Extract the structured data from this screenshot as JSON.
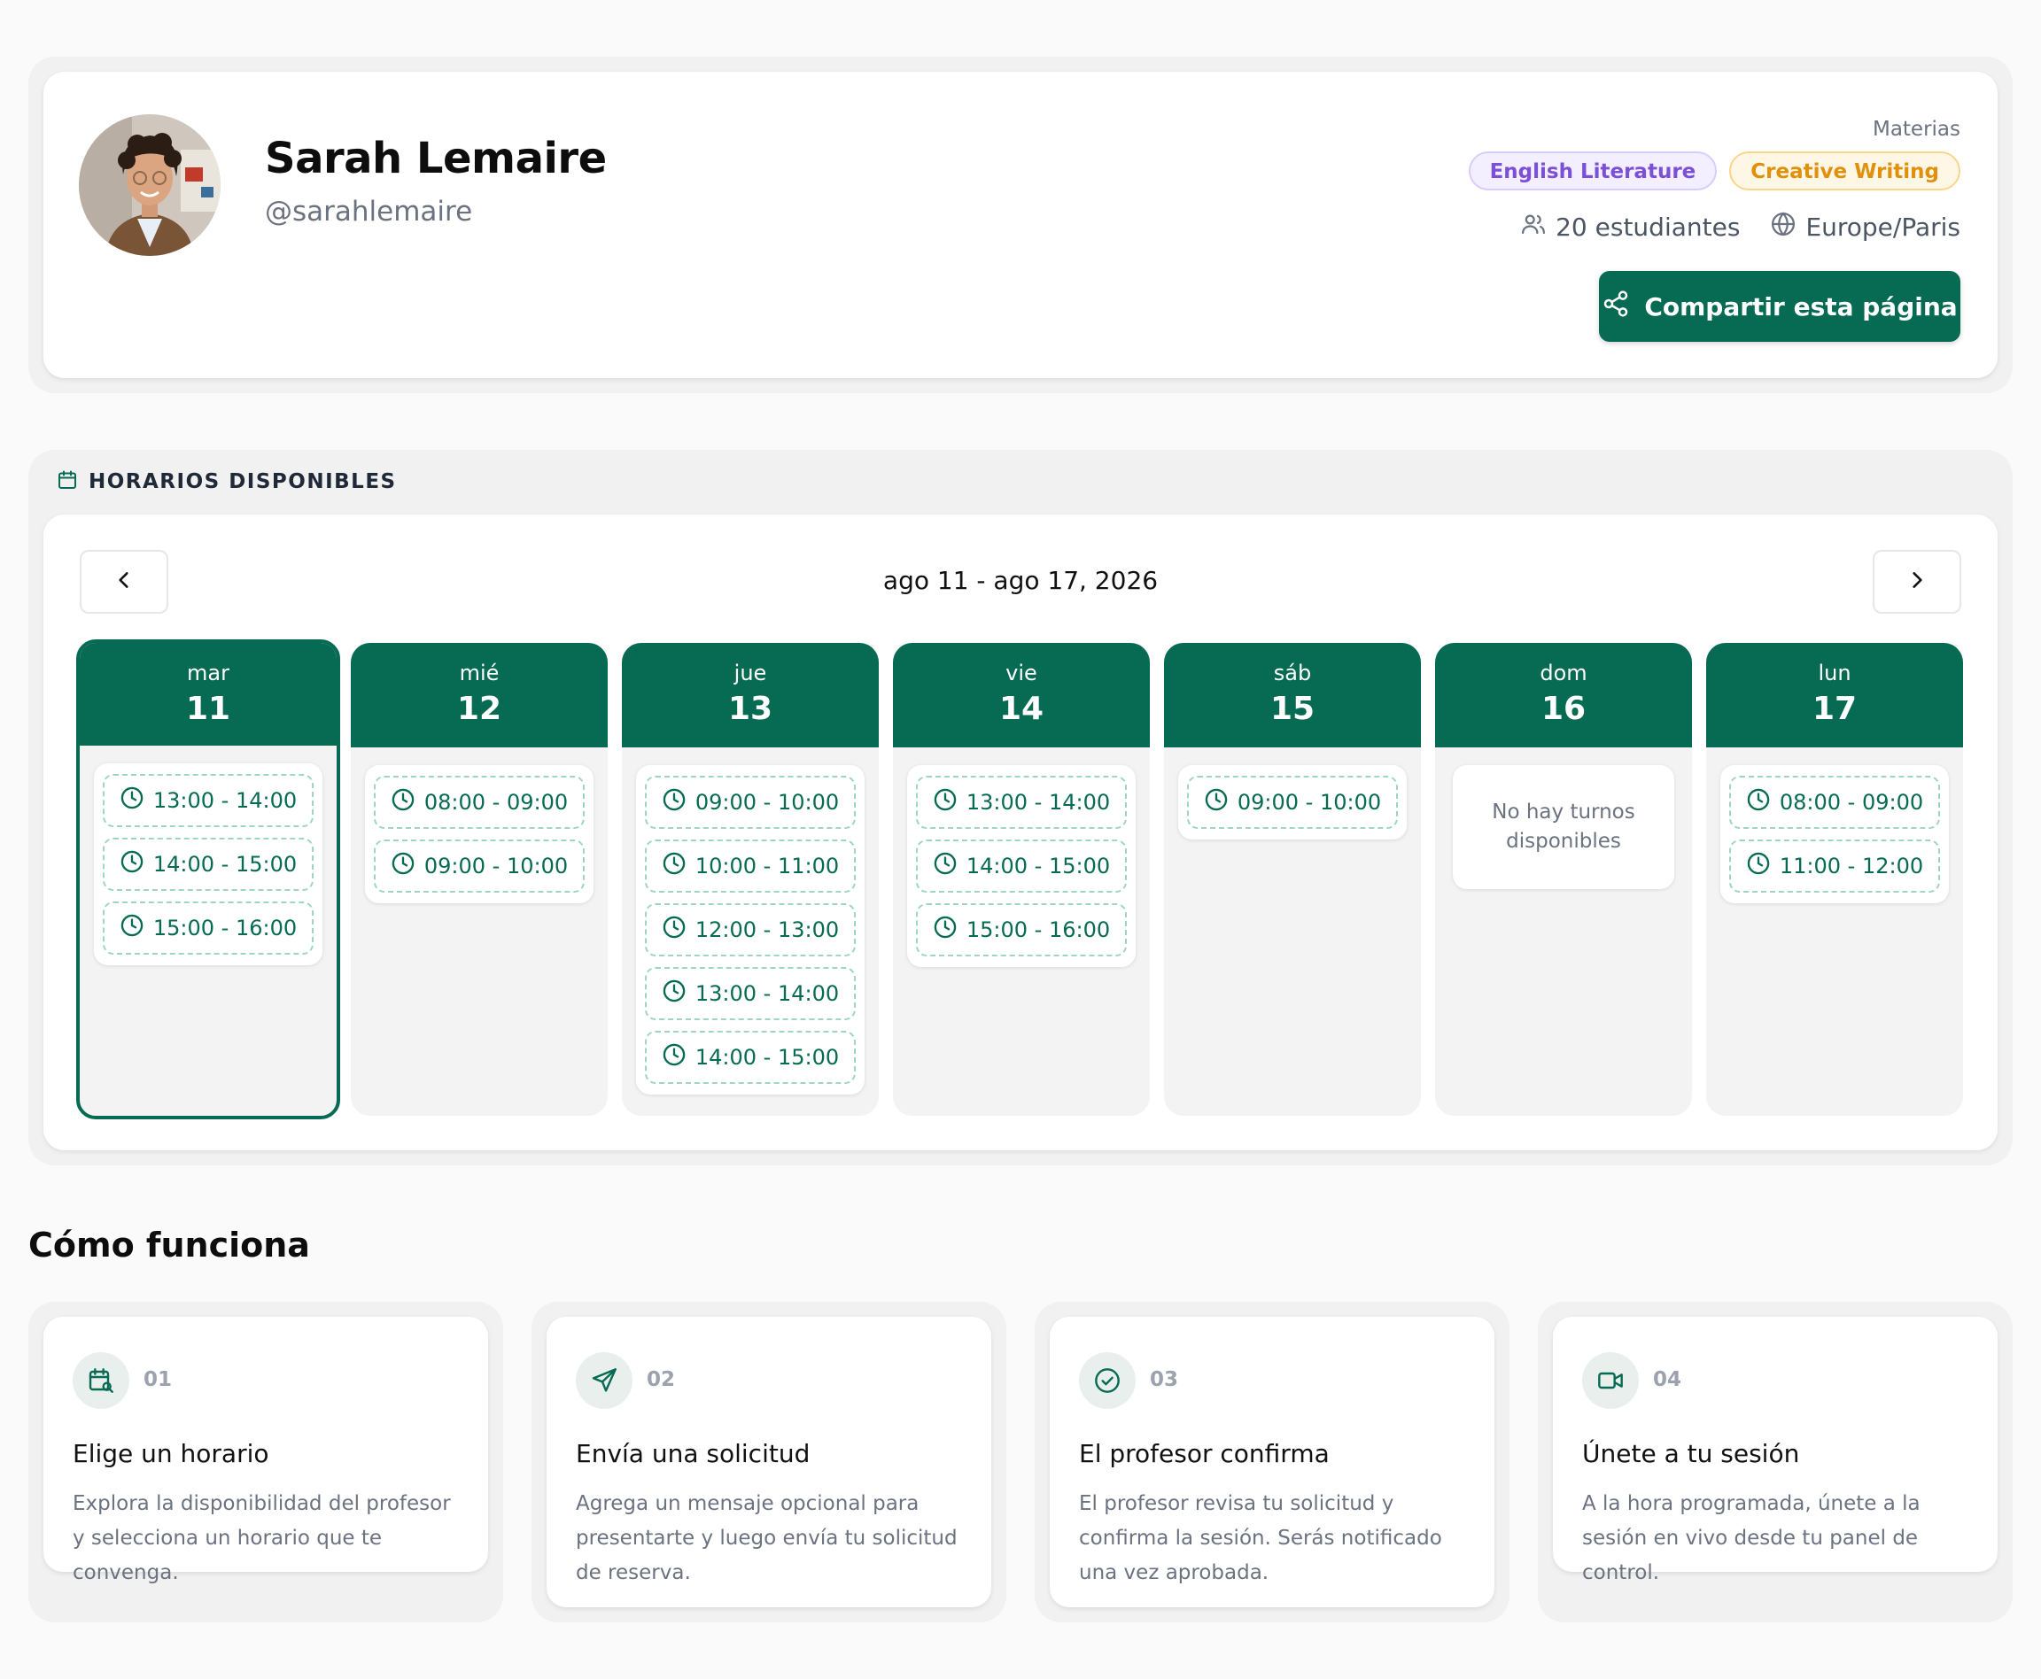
{
  "profile": {
    "name": "Sarah Lemaire",
    "handle": "@sarahlemaire",
    "subjects_label": "Materias",
    "subjects": [
      "English Literature",
      "Creative Writing"
    ],
    "students": "20 estudiantes",
    "timezone": "Europe/Paris",
    "share_label": "Compartir esta página"
  },
  "availability": {
    "title": "HORARIOS DISPONIBLES",
    "week_range": "ago 11 - ago 17, 2026",
    "empty_text": "No hay turnos disponibles",
    "days": [
      {
        "name": "mar",
        "num": "11",
        "slots": [
          "13:00 - 14:00",
          "14:00 - 15:00",
          "15:00 - 16:00"
        ]
      },
      {
        "name": "mié",
        "num": "12",
        "slots": [
          "08:00 - 09:00",
          "09:00 - 10:00"
        ]
      },
      {
        "name": "jue",
        "num": "13",
        "slots": [
          "09:00 - 10:00",
          "10:00 - 11:00",
          "12:00 - 13:00",
          "13:00 - 14:00",
          "14:00 - 15:00"
        ]
      },
      {
        "name": "vie",
        "num": "14",
        "slots": [
          "13:00 - 14:00",
          "14:00 - 15:00",
          "15:00 - 16:00"
        ]
      },
      {
        "name": "sáb",
        "num": "15",
        "slots": [
          "09:00 - 10:00"
        ]
      },
      {
        "name": "dom",
        "num": "16",
        "slots": []
      },
      {
        "name": "lun",
        "num": "17",
        "slots": [
          "08:00 - 09:00",
          "11:00 - 12:00"
        ]
      }
    ]
  },
  "how": {
    "title": "Cómo funciona",
    "steps": [
      {
        "num": "01",
        "icon": "calendar-search-icon",
        "title": "Elige un horario",
        "desc": "Explora la disponibilidad del profesor y selecciona un horario que te convenga."
      },
      {
        "num": "02",
        "icon": "send-icon",
        "title": "Envía una solicitud",
        "desc": "Agrega un mensaje opcional para presentarte y luego envía tu solicitud de reserva."
      },
      {
        "num": "03",
        "icon": "check-circle-icon",
        "title": "El profesor confirma",
        "desc": "El profesor revisa tu solicitud y confirma la sesión. Serás notificado una vez aprobada."
      },
      {
        "num": "04",
        "icon": "video-icon",
        "title": "Únete a tu sesión",
        "desc": "A la hora programada, únete a la sesión en vivo desde tu panel de control."
      }
    ]
  },
  "colors": {
    "primary": "#066b52",
    "slot_border": "#9fd6c1",
    "badge_purple": "#7b4fd6",
    "badge_amber": "#e0900a"
  }
}
